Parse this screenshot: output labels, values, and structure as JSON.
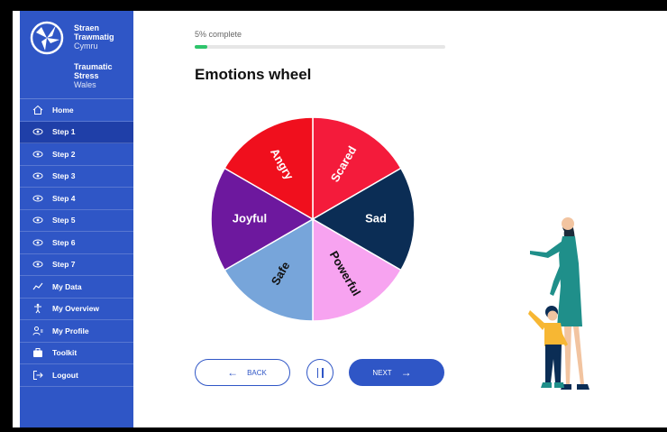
{
  "brand": {
    "welsh_line1": "Straen",
    "welsh_line2": "Trawmatig",
    "welsh_line3": "Cymru",
    "english_line1": "Traumatic",
    "english_line2": "Stress",
    "english_line3": "Wales"
  },
  "sidebar": {
    "items": [
      {
        "label": "Home",
        "icon": "home-icon"
      },
      {
        "label": "Step 1",
        "icon": "eye-icon",
        "active": true
      },
      {
        "label": "Step 2",
        "icon": "eye-icon"
      },
      {
        "label": "Step 3",
        "icon": "eye-icon"
      },
      {
        "label": "Step 4",
        "icon": "eye-icon"
      },
      {
        "label": "Step 5",
        "icon": "eye-icon"
      },
      {
        "label": "Step 6",
        "icon": "eye-icon"
      },
      {
        "label": "Step 7",
        "icon": "eye-icon"
      },
      {
        "label": "My Data",
        "icon": "chart-line-icon"
      },
      {
        "label": "My Overview",
        "icon": "person-icon"
      },
      {
        "label": "My Profile",
        "icon": "profile-icon"
      },
      {
        "label": "Toolkit",
        "icon": "briefcase-icon"
      },
      {
        "label": "Logout",
        "icon": "logout-icon"
      }
    ]
  },
  "progress": {
    "label": "5% complete",
    "percent": 5,
    "color": "#2ec46b"
  },
  "main": {
    "title": "Emotions wheel"
  },
  "wheel": {
    "segments": [
      {
        "label": "Scared",
        "color": "#f41b3b"
      },
      {
        "label": "Sad",
        "color": "#0b2d55"
      },
      {
        "label": "Powerful",
        "color": "#f7a3f0"
      },
      {
        "label": "Safe",
        "color": "#77a5da"
      },
      {
        "label": "Joyful",
        "color": "#6d189e"
      },
      {
        "label": "Angry",
        "color": "#f00f1d"
      }
    ]
  },
  "nav_buttons": {
    "back_label": "BACK",
    "next_label": "NEXT"
  },
  "colors": {
    "primary": "#2f56c6",
    "sidebar_active": "#1f3fa8"
  }
}
